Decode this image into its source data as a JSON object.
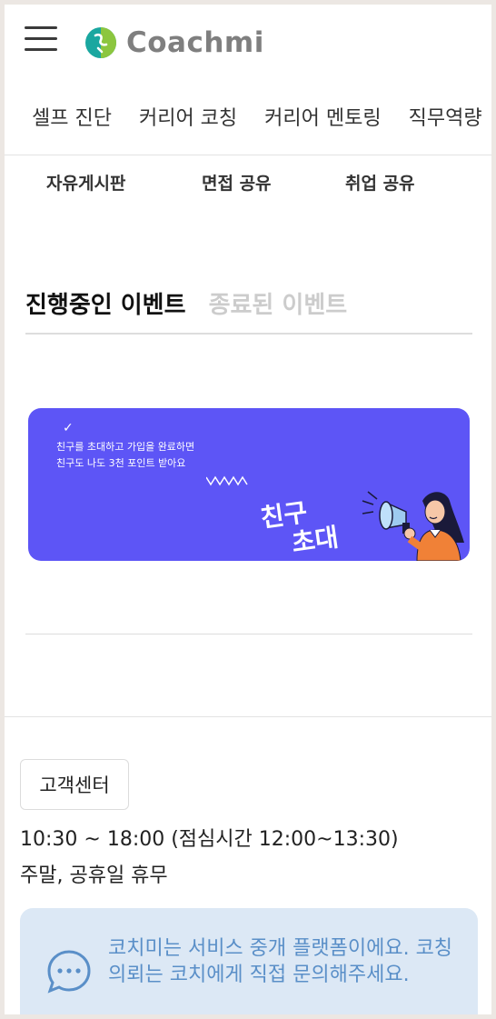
{
  "header": {
    "logo_text": "Coachmi",
    "menu_icon": "hamburger-menu-icon",
    "logo_icon": "coachmi-logo-icon",
    "brand_colors": [
      "#1aa7a0",
      "#8cc63f"
    ]
  },
  "main_nav": {
    "items": [
      "셀프 진단",
      "커리어 코칭",
      "커리어 멘토링",
      "직무역량"
    ]
  },
  "sub_nav": {
    "items": [
      "자유게시판",
      "면접 공유",
      "취업 공유"
    ]
  },
  "event_tabs": {
    "active": "진행중인 이벤트",
    "inactive": "종료된 이벤트"
  },
  "banner": {
    "line1": "친구를 초대하고 가입을 완료하면",
    "line2": "친구도 나도 3천 포인트 받아요",
    "title_line1": "친구",
    "title_line2": "초대",
    "bg_color": "#5d55f6"
  },
  "footer": {
    "cs_button": "고객센터",
    "hours": "10:30 ~ 18:00 (점심시간 12:00~13:30)",
    "holiday": "주말, 공휴일 휴무",
    "notice_text": "코치미는 서비스 중개 플랫폼이에요. 코칭의뢰는 코치에게 직접 문의해주세요.",
    "notice_icon": "chat-bubble-icon",
    "notice_bg": "#dce8f5",
    "notice_color": "#5a8fc8"
  }
}
